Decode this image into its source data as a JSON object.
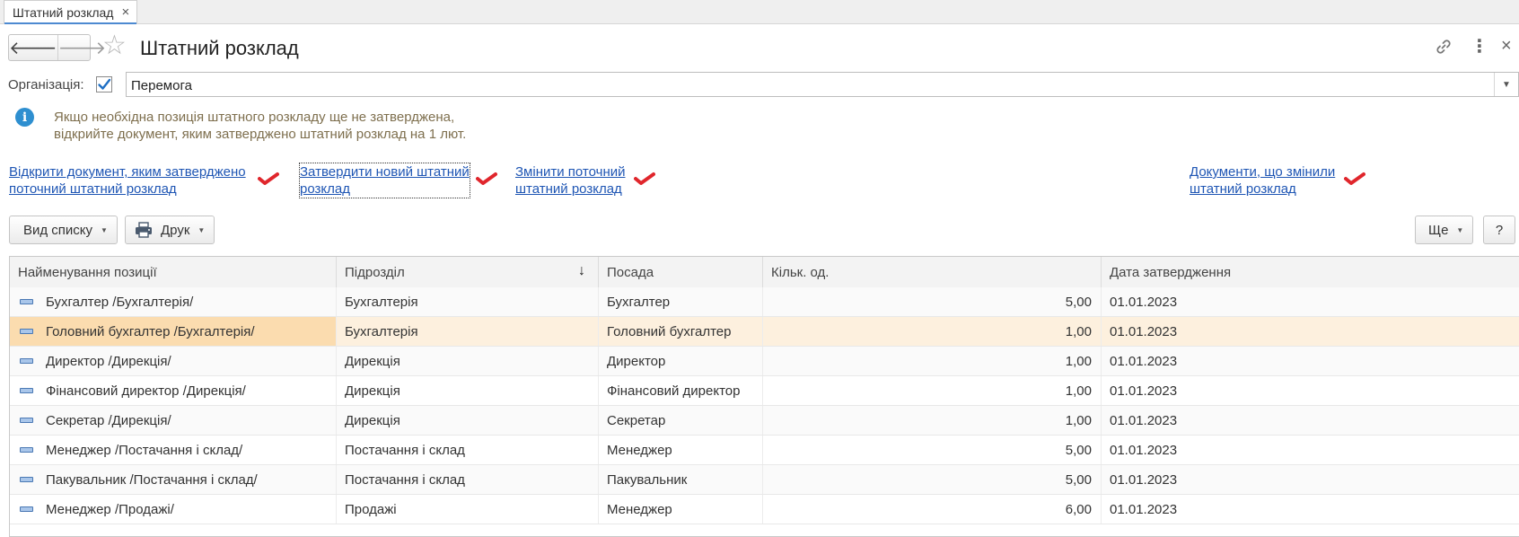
{
  "tab": {
    "label": "Штатний розклад",
    "close": "×"
  },
  "header": {
    "back": "🡐",
    "forward": "🡒",
    "title": "Штатний розклад",
    "link_icon": "link-icon",
    "more_icon": "⋮",
    "close": "×"
  },
  "organization": {
    "label": "Організація:",
    "checked": true,
    "value": "Перемога"
  },
  "info": {
    "line1": "Якщо необхідна позиція штатного розкладу ще не затверджена,",
    "line2": "відкрийте документ, яким затверджено штатний розклад на 1 лют."
  },
  "links": [
    {
      "line1": "Відкрити документ, яким затверджено",
      "line2": "поточний штатний розклад"
    },
    {
      "line1": "Затвердити новий штатний",
      "line2": "розклад"
    },
    {
      "line1": "Змінити поточний",
      "line2": "штатний розклад"
    },
    {
      "line1": "Документи, що змінили",
      "line2": "штатний розклад"
    }
  ],
  "toolbar": {
    "list_view": "Вид списку",
    "print": "Друк",
    "more": "Ще",
    "help": "?"
  },
  "table": {
    "columns": [
      "Найменування позиції",
      "Підрозділ",
      "Посада",
      "Кільк. од.",
      "Дата затвердження"
    ],
    "sort_indicator": "↓",
    "rows": [
      [
        "Бухгалтер /Бухгалтерія/",
        "Бухгалтерія",
        "Бухгалтер",
        "5,00",
        "01.01.2023"
      ],
      [
        "Головний бухгалтер /Бухгалтерія/",
        "Бухгалтерія",
        "Головний бухгалтер",
        "1,00",
        "01.01.2023"
      ],
      [
        "Директор /Дирекція/",
        "Дирекція",
        "Директор",
        "1,00",
        "01.01.2023"
      ],
      [
        "Фінансовий директор /Дирекція/",
        "Дирекція",
        "Фінансовий директор",
        "1,00",
        "01.01.2023"
      ],
      [
        "Секретар /Дирекція/",
        "Дирекція",
        "Секретар",
        "1,00",
        "01.01.2023"
      ],
      [
        "Менеджер /Постачання і склад/",
        "Постачання і склад",
        "Менеджер",
        "5,00",
        "01.01.2023"
      ],
      [
        "Пакувальник /Постачання і склад/",
        "Постачання і склад",
        "Пакувальник",
        "5,00",
        "01.01.2023"
      ],
      [
        "Менеджер /Продажі/",
        "Продажі",
        "Менеджер",
        "6,00",
        "01.01.2023"
      ]
    ],
    "selected_row": 1
  },
  "colors": {
    "link": "#1f56b4",
    "info_text": "#7e6f4e",
    "check_red": "#e0262c",
    "selected_row": "#fdf0de"
  }
}
